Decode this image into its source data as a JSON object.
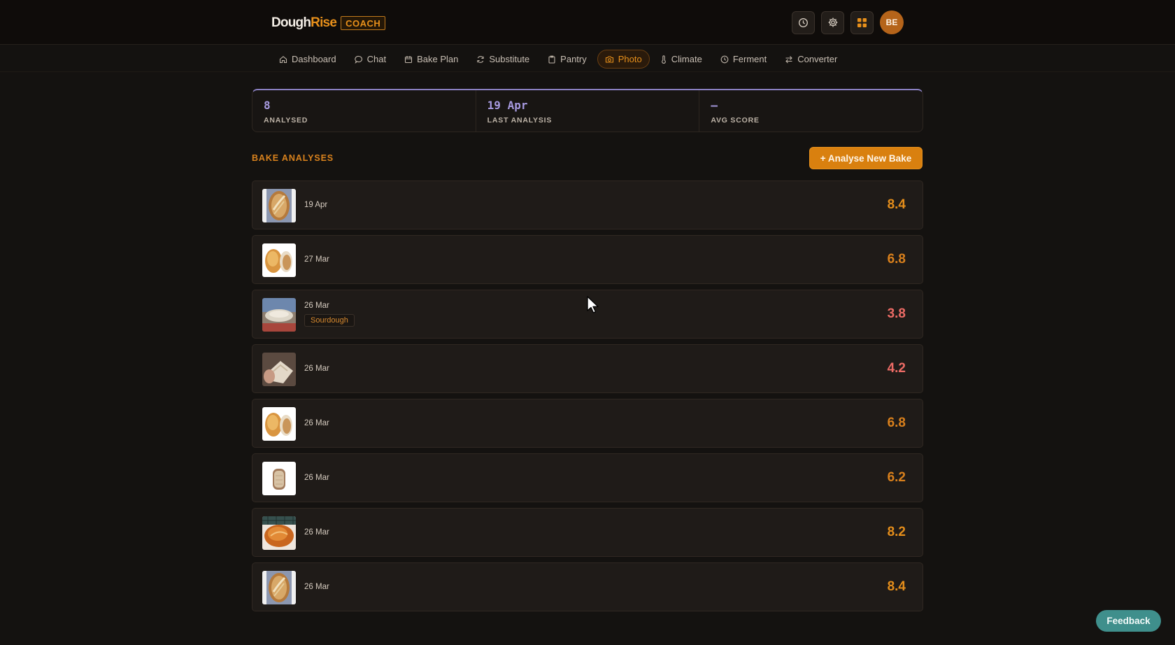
{
  "brand": {
    "name_part1": "Dough",
    "name_part2": "Rise",
    "badge": "COACH"
  },
  "header": {
    "icons": [
      "history-icon",
      "settings-icon",
      "apps-grid-icon"
    ],
    "avatar_initials": "BE"
  },
  "nav": {
    "items": [
      {
        "label": "Dashboard",
        "icon": "home-icon",
        "active": false
      },
      {
        "label": "Chat",
        "icon": "chat-icon",
        "active": false
      },
      {
        "label": "Bake Plan",
        "icon": "calendar-icon",
        "active": false
      },
      {
        "label": "Substitute",
        "icon": "refresh-icon",
        "active": false
      },
      {
        "label": "Pantry",
        "icon": "clipboard-icon",
        "active": false
      },
      {
        "label": "Photo",
        "icon": "camera-icon",
        "active": true
      },
      {
        "label": "Climate",
        "icon": "thermometer-icon",
        "active": false
      },
      {
        "label": "Ferment",
        "icon": "clock-icon",
        "active": false
      },
      {
        "label": "Converter",
        "icon": "swap-icon",
        "active": false
      }
    ]
  },
  "stats": [
    {
      "value": "8",
      "label": "ANALYSED"
    },
    {
      "value": "19 Apr",
      "label": "LAST ANALYSIS"
    },
    {
      "value": "—",
      "label": "AVG SCORE"
    }
  ],
  "section": {
    "title": "BAKE ANALYSES",
    "new_button": "+ Analyse New Bake"
  },
  "analyses": [
    {
      "date": "19 Apr",
      "tag": "",
      "score": "8.4",
      "level": "high",
      "thumb": "scored-loaf-photo"
    },
    {
      "date": "27 Mar",
      "tag": "",
      "score": "6.8",
      "level": "mid",
      "thumb": "two-loaves-photo"
    },
    {
      "date": "26 Mar",
      "tag": "Sourdough",
      "score": "3.8",
      "level": "low",
      "thumb": "flat-bread-outdoor-photo"
    },
    {
      "date": "26 Mar",
      "tag": "",
      "score": "4.2",
      "level": "low",
      "thumb": "hand-holding-slice-photo"
    },
    {
      "date": "26 Mar",
      "tag": "",
      "score": "6.8",
      "level": "mid",
      "thumb": "two-loaves-photo"
    },
    {
      "date": "26 Mar",
      "tag": "",
      "score": "6.2",
      "level": "mid",
      "thumb": "sliced-loaf-photo"
    },
    {
      "date": "26 Mar",
      "tag": "",
      "score": "8.2",
      "level": "high",
      "thumb": "boule-on-board-photo"
    },
    {
      "date": "26 Mar",
      "tag": "",
      "score": "8.4",
      "level": "high",
      "thumb": "scored-loaf-photo"
    }
  ],
  "feedback": {
    "label": "Feedback"
  },
  "colors": {
    "accent": "#e8901b",
    "stat_value": "#a79ae0",
    "score_low": "#ec6b65",
    "feedback": "#3f8f8c"
  }
}
